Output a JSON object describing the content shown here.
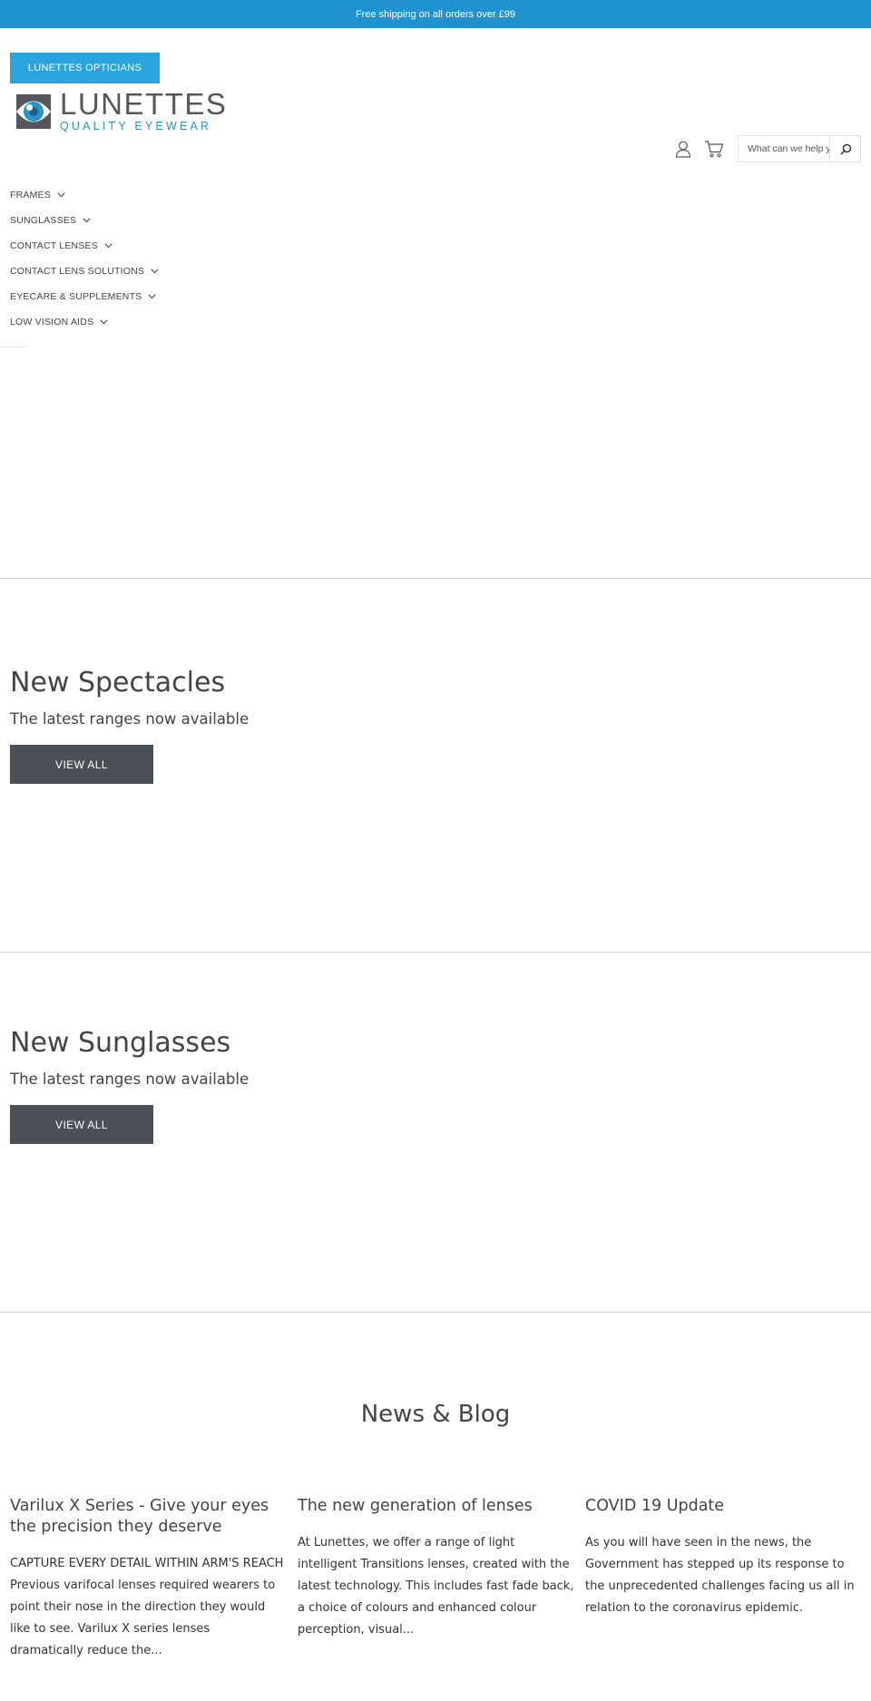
{
  "announcement": "Free shipping on all orders over £99",
  "header": {
    "opticians_label": "LUNETTES OPTICIANS",
    "logo_name": "LUNETTES",
    "logo_tagline": "QUALITY EYEWEAR",
    "icons": {
      "account": "user-icon",
      "cart": "cart-icon",
      "search": "search-icon"
    },
    "search": {
      "placeholder": "What can we help you find?"
    }
  },
  "nav": {
    "items": [
      {
        "label": "FRAMES"
      },
      {
        "label": "SUNGLASSES"
      },
      {
        "label": "CONTACT LENSES"
      },
      {
        "label": "CONTACT LENS SOLUTIONS"
      },
      {
        "label": "EYECARE & SUPPLEMENTS"
      },
      {
        "label": "LOW VISION AIDS"
      }
    ]
  },
  "promos": [
    {
      "title": "New Spectacles",
      "subtitle": "The latest ranges now available",
      "button": "VIEW ALL"
    },
    {
      "title": "New Sunglasses",
      "subtitle": "The latest ranges now available",
      "button": "VIEW ALL"
    }
  ],
  "blog": {
    "heading": "News & Blog",
    "posts": [
      {
        "title": "Varilux X Series - Give your eyes the precision they deserve",
        "excerpt": "CAPTURE EVERY DETAIL WITHIN ARM'S REACH Previous varifocal lenses required wearers to point their nose in the direction they would like to see. Varilux X series lenses dramatically reduce the..."
      },
      {
        "title": "The new generation of lenses",
        "excerpt": "At Lunettes, we offer a range of light intelligent Transitions lenses, created with the latest technology. This includes fast fade back, a choice of colours and enhanced colour perception, visual..."
      },
      {
        "title": "COVID 19 Update",
        "excerpt": "As you will have seen in the news, the Government has stepped up its response to the unprecedented challenges facing us all in relation to the coronavirus epidemic."
      }
    ]
  },
  "colors": {
    "announcement_bg": "#2192d0",
    "opticians_btn_bg": "#2aa4de",
    "view_all_btn_bg": "#4b5056",
    "logo_blue": "#2a93cc",
    "text": "#444444"
  }
}
